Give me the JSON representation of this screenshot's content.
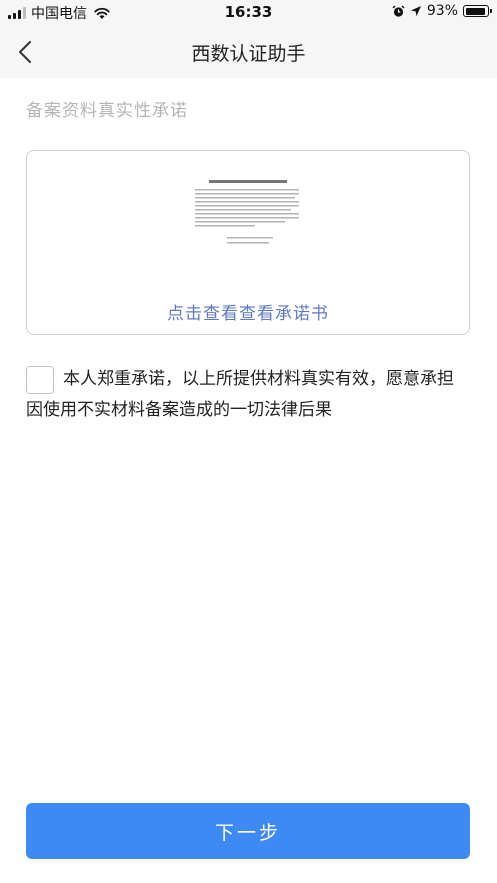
{
  "status_bar": {
    "carrier": "中国电信",
    "time": "16:33",
    "battery": "93%",
    "battery_level": 0.93,
    "icons": [
      "signal-icon",
      "wifi-icon",
      "alarm-icon",
      "location-icon",
      "battery-icon"
    ]
  },
  "nav": {
    "title": "西数认证助手",
    "back_icon": "chevron-left-icon"
  },
  "section_title": "备案资料真实性承诺",
  "document": {
    "view_link": "点击查看查看承诺书"
  },
  "agreement": {
    "checked": false,
    "text": "本人郑重承诺，以上所提供材料真实有效，愿意承担因使用不实材料备案造成的一切法律后果"
  },
  "next_button": "下一步",
  "colors": {
    "primary": "#3e8af2",
    "link": "#5f7ac2",
    "header_bg": "#f6f6f6",
    "muted_text": "#b5b5b5"
  }
}
